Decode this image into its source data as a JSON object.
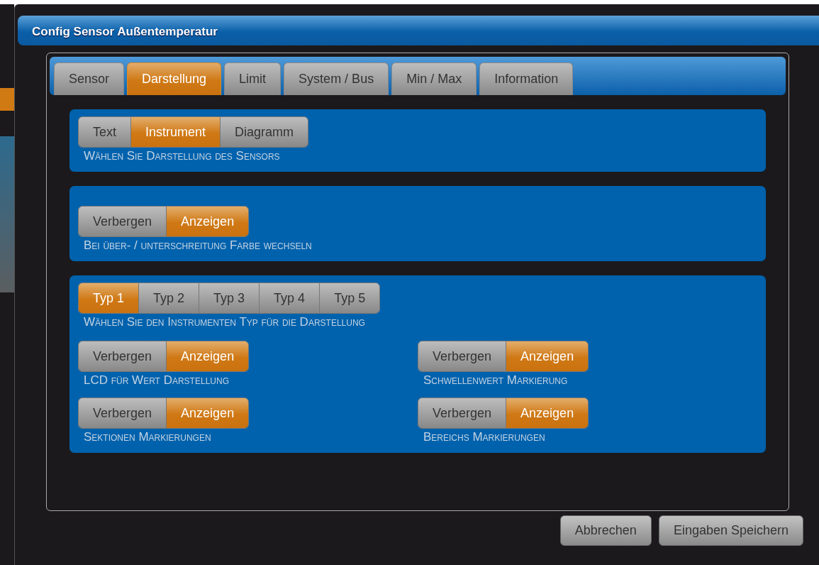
{
  "dialog": {
    "title": "Config Sensor Außentemperatur"
  },
  "tabs": [
    {
      "label": "Sensor",
      "selected": false
    },
    {
      "label": "Darstellung",
      "selected": true
    },
    {
      "label": "Limit",
      "selected": false
    },
    {
      "label": "System / Bus",
      "selected": false
    },
    {
      "label": "Min / Max",
      "selected": false
    },
    {
      "label": "Information",
      "selected": false
    }
  ],
  "sections": [
    {
      "kind": "single",
      "groups": [
        {
          "options": [
            {
              "label": "Text",
              "selected": false
            },
            {
              "label": "Instrument",
              "selected": true
            },
            {
              "label": "Diagramm",
              "selected": false
            }
          ],
          "caption": "Wählen Sie Darstellung des Sensors"
        }
      ]
    },
    {
      "kind": "spaced",
      "groups": [
        {
          "options": [
            {
              "label": "Verbergen",
              "selected": false
            },
            {
              "label": "Anzeigen",
              "selected": true
            }
          ],
          "caption": "Bei über- / unterschreitung Farbe wechseln"
        }
      ]
    },
    {
      "kind": "grid",
      "groups": [
        {
          "options": [
            {
              "label": "Typ 1",
              "selected": true
            },
            {
              "label": "Typ 2",
              "selected": false
            },
            {
              "label": "Typ 3",
              "selected": false
            },
            {
              "label": "Typ 4",
              "selected": false
            },
            {
              "label": "Typ 5",
              "selected": false
            }
          ],
          "caption": "Wählen Sie den Instrumenten Typ für die Darstellung"
        },
        {
          "options": [
            {
              "label": "Verbergen",
              "selected": false
            },
            {
              "label": "Anzeigen",
              "selected": true
            }
          ],
          "caption": "LCD für Wert Darstellung"
        },
        {
          "options": [
            {
              "label": "Verbergen",
              "selected": false
            },
            {
              "label": "Anzeigen",
              "selected": true
            }
          ],
          "caption": "Schwellenwert Markierung"
        },
        {
          "options": [
            {
              "label": "Verbergen",
              "selected": false
            },
            {
              "label": "Anzeigen",
              "selected": true
            }
          ],
          "caption": "Sektionen Markierungen"
        },
        {
          "options": [
            {
              "label": "Verbergen",
              "selected": false
            },
            {
              "label": "Anzeigen",
              "selected": true
            }
          ],
          "caption": "Bereichs Markierungen"
        }
      ]
    }
  ],
  "buttons": [
    "Abbrechen",
    "Eingaben Speichern"
  ]
}
